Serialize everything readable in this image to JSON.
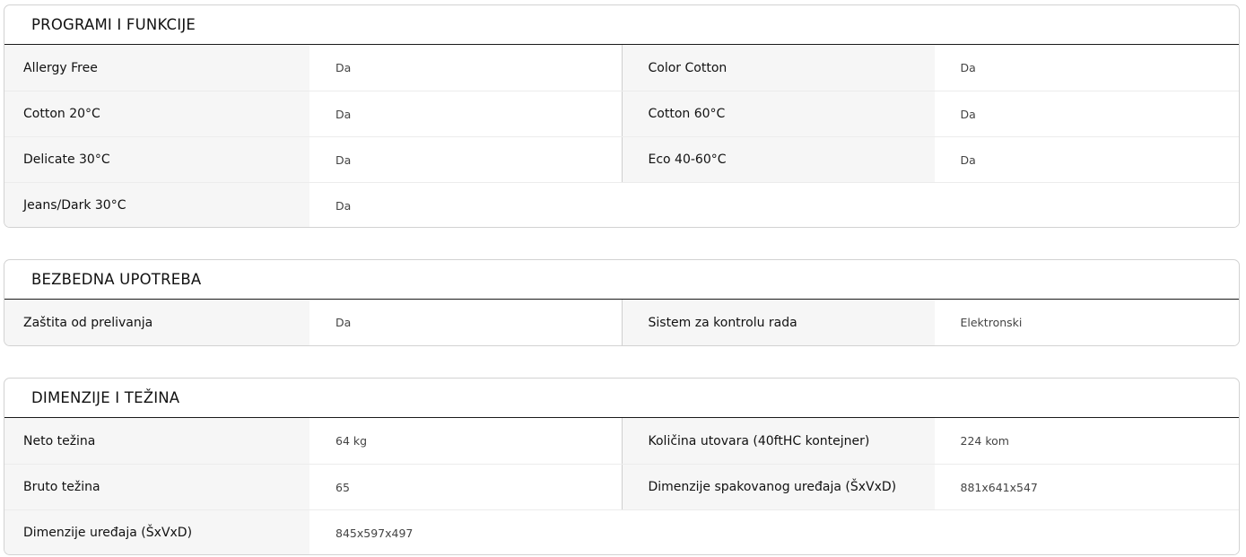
{
  "sections": [
    {
      "title": "PROGRAMI I FUNKCIJE",
      "rows": [
        [
          {
            "label": "Allergy Free",
            "value": "Da"
          },
          {
            "label": "Color Cotton",
            "value": "Da"
          }
        ],
        [
          {
            "label": "Cotton 20°C",
            "value": "Da"
          },
          {
            "label": "Cotton 60°C",
            "value": "Da"
          }
        ],
        [
          {
            "label": "Delicate 30°C",
            "value": "Da"
          },
          {
            "label": "Eco 40-60°C",
            "value": "Da"
          }
        ],
        [
          {
            "label": "Jeans/Dark 30°C",
            "value": "Da"
          }
        ]
      ]
    },
    {
      "title": "BEZBEDNA UPOTREBA",
      "rows": [
        [
          {
            "label": "Zaštita od prelivanja",
            "value": "Da"
          },
          {
            "label": "Sistem za kontrolu rada",
            "value": "Elektronski"
          }
        ]
      ]
    },
    {
      "title": "DIMENZIJE I TEŽINA",
      "rows": [
        [
          {
            "label": "Neto težina",
            "value": "64 kg"
          },
          {
            "label": "Količina utovara (40ftHC kontejner)",
            "value": "224 kom"
          }
        ],
        [
          {
            "label": "Bruto težina",
            "value": "65"
          },
          {
            "label": "Dimenzije spakovanog uređaja (ŠxVxD)",
            "value": "881x641x547"
          }
        ],
        [
          {
            "label": "Dimenzije uređaja (ŠxVxD)",
            "value": "845x597x497"
          }
        ]
      ]
    }
  ]
}
